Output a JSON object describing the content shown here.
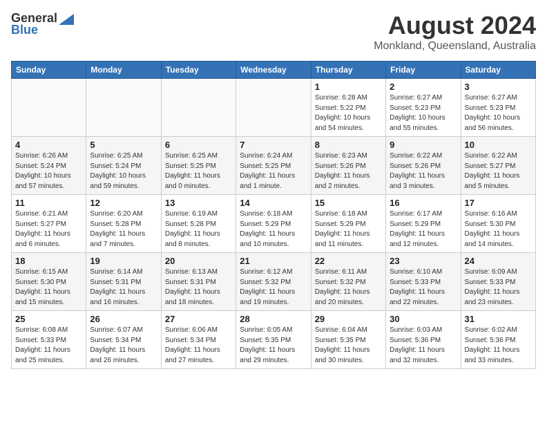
{
  "logo": {
    "general": "General",
    "blue": "Blue"
  },
  "header": {
    "month": "August 2024",
    "location": "Monkland, Queensland, Australia"
  },
  "weekdays": [
    "Sunday",
    "Monday",
    "Tuesday",
    "Wednesday",
    "Thursday",
    "Friday",
    "Saturday"
  ],
  "weeks": [
    [
      {
        "day": "",
        "info": ""
      },
      {
        "day": "",
        "info": ""
      },
      {
        "day": "",
        "info": ""
      },
      {
        "day": "",
        "info": ""
      },
      {
        "day": "1",
        "info": "Sunrise: 6:28 AM\nSunset: 5:22 PM\nDaylight: 10 hours\nand 54 minutes."
      },
      {
        "day": "2",
        "info": "Sunrise: 6:27 AM\nSunset: 5:23 PM\nDaylight: 10 hours\nand 55 minutes."
      },
      {
        "day": "3",
        "info": "Sunrise: 6:27 AM\nSunset: 5:23 PM\nDaylight: 10 hours\nand 56 minutes."
      }
    ],
    [
      {
        "day": "4",
        "info": "Sunrise: 6:26 AM\nSunset: 5:24 PM\nDaylight: 10 hours\nand 57 minutes."
      },
      {
        "day": "5",
        "info": "Sunrise: 6:25 AM\nSunset: 5:24 PM\nDaylight: 10 hours\nand 59 minutes."
      },
      {
        "day": "6",
        "info": "Sunrise: 6:25 AM\nSunset: 5:25 PM\nDaylight: 11 hours\nand 0 minutes."
      },
      {
        "day": "7",
        "info": "Sunrise: 6:24 AM\nSunset: 5:25 PM\nDaylight: 11 hours\nand 1 minute."
      },
      {
        "day": "8",
        "info": "Sunrise: 6:23 AM\nSunset: 5:26 PM\nDaylight: 11 hours\nand 2 minutes."
      },
      {
        "day": "9",
        "info": "Sunrise: 6:22 AM\nSunset: 5:26 PM\nDaylight: 11 hours\nand 3 minutes."
      },
      {
        "day": "10",
        "info": "Sunrise: 6:22 AM\nSunset: 5:27 PM\nDaylight: 11 hours\nand 5 minutes."
      }
    ],
    [
      {
        "day": "11",
        "info": "Sunrise: 6:21 AM\nSunset: 5:27 PM\nDaylight: 11 hours\nand 6 minutes."
      },
      {
        "day": "12",
        "info": "Sunrise: 6:20 AM\nSunset: 5:28 PM\nDaylight: 11 hours\nand 7 minutes."
      },
      {
        "day": "13",
        "info": "Sunrise: 6:19 AM\nSunset: 5:28 PM\nDaylight: 11 hours\nand 8 minutes."
      },
      {
        "day": "14",
        "info": "Sunrise: 6:18 AM\nSunset: 5:29 PM\nDaylight: 11 hours\nand 10 minutes."
      },
      {
        "day": "15",
        "info": "Sunrise: 6:18 AM\nSunset: 5:29 PM\nDaylight: 11 hours\nand 11 minutes."
      },
      {
        "day": "16",
        "info": "Sunrise: 6:17 AM\nSunset: 5:29 PM\nDaylight: 11 hours\nand 12 minutes."
      },
      {
        "day": "17",
        "info": "Sunrise: 6:16 AM\nSunset: 5:30 PM\nDaylight: 11 hours\nand 14 minutes."
      }
    ],
    [
      {
        "day": "18",
        "info": "Sunrise: 6:15 AM\nSunset: 5:30 PM\nDaylight: 11 hours\nand 15 minutes."
      },
      {
        "day": "19",
        "info": "Sunrise: 6:14 AM\nSunset: 5:31 PM\nDaylight: 11 hours\nand 16 minutes."
      },
      {
        "day": "20",
        "info": "Sunrise: 6:13 AM\nSunset: 5:31 PM\nDaylight: 11 hours\nand 18 minutes."
      },
      {
        "day": "21",
        "info": "Sunrise: 6:12 AM\nSunset: 5:32 PM\nDaylight: 11 hours\nand 19 minutes."
      },
      {
        "day": "22",
        "info": "Sunrise: 6:11 AM\nSunset: 5:32 PM\nDaylight: 11 hours\nand 20 minutes."
      },
      {
        "day": "23",
        "info": "Sunrise: 6:10 AM\nSunset: 5:33 PM\nDaylight: 11 hours\nand 22 minutes."
      },
      {
        "day": "24",
        "info": "Sunrise: 6:09 AM\nSunset: 5:33 PM\nDaylight: 11 hours\nand 23 minutes."
      }
    ],
    [
      {
        "day": "25",
        "info": "Sunrise: 6:08 AM\nSunset: 5:33 PM\nDaylight: 11 hours\nand 25 minutes."
      },
      {
        "day": "26",
        "info": "Sunrise: 6:07 AM\nSunset: 5:34 PM\nDaylight: 11 hours\nand 26 minutes."
      },
      {
        "day": "27",
        "info": "Sunrise: 6:06 AM\nSunset: 5:34 PM\nDaylight: 11 hours\nand 27 minutes."
      },
      {
        "day": "28",
        "info": "Sunrise: 6:05 AM\nSunset: 5:35 PM\nDaylight: 11 hours\nand 29 minutes."
      },
      {
        "day": "29",
        "info": "Sunrise: 6:04 AM\nSunset: 5:35 PM\nDaylight: 11 hours\nand 30 minutes."
      },
      {
        "day": "30",
        "info": "Sunrise: 6:03 AM\nSunset: 5:36 PM\nDaylight: 11 hours\nand 32 minutes."
      },
      {
        "day": "31",
        "info": "Sunrise: 6:02 AM\nSunset: 5:36 PM\nDaylight: 11 hours\nand 33 minutes."
      }
    ]
  ]
}
